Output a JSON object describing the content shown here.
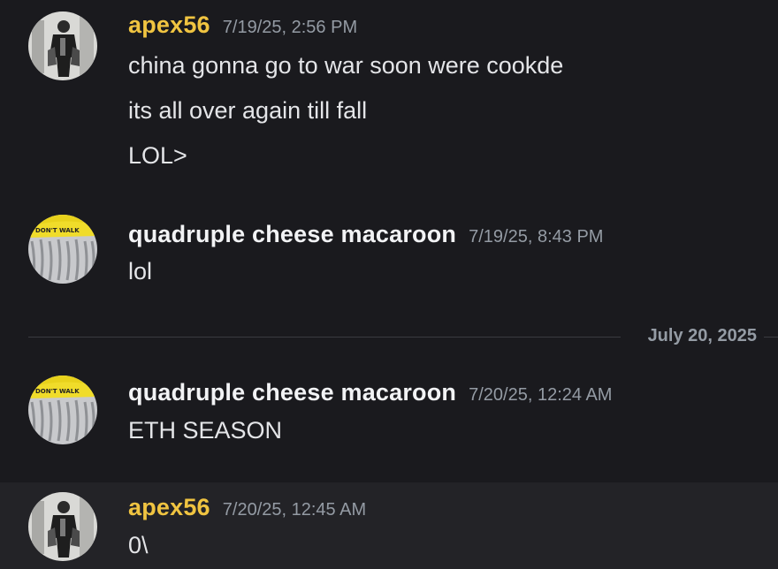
{
  "colors": {
    "background": "#1a1a1e",
    "highlight_row": "#232327",
    "apex_username": "#f0c441",
    "macaroon_username": "#f2f3f5",
    "timestamp": "#949ba4",
    "message_text": "#e4e5e8"
  },
  "messages": [
    {
      "author": "apex56",
      "timestamp": "7/19/25, 2:56 PM",
      "avatar": "apex56-avatar",
      "lines": [
        "china gonna go to war soon were cookde",
        "its all over again till fall",
        "LOL>"
      ]
    },
    {
      "author": "quadruple cheese macaroon",
      "timestamp": "7/19/25, 8:43 PM",
      "avatar": "macaroon-avatar",
      "lines": [
        "lol"
      ]
    },
    {
      "author": "quadruple cheese macaroon",
      "timestamp": "7/20/25, 12:24 AM",
      "avatar": "macaroon-avatar",
      "lines": [
        "ETH SEASON"
      ]
    },
    {
      "author": "apex56",
      "timestamp": "7/20/25, 12:45 AM",
      "avatar": "apex56-avatar",
      "lines": [
        "0\\"
      ]
    }
  ],
  "date_divider": "July 20, 2025"
}
